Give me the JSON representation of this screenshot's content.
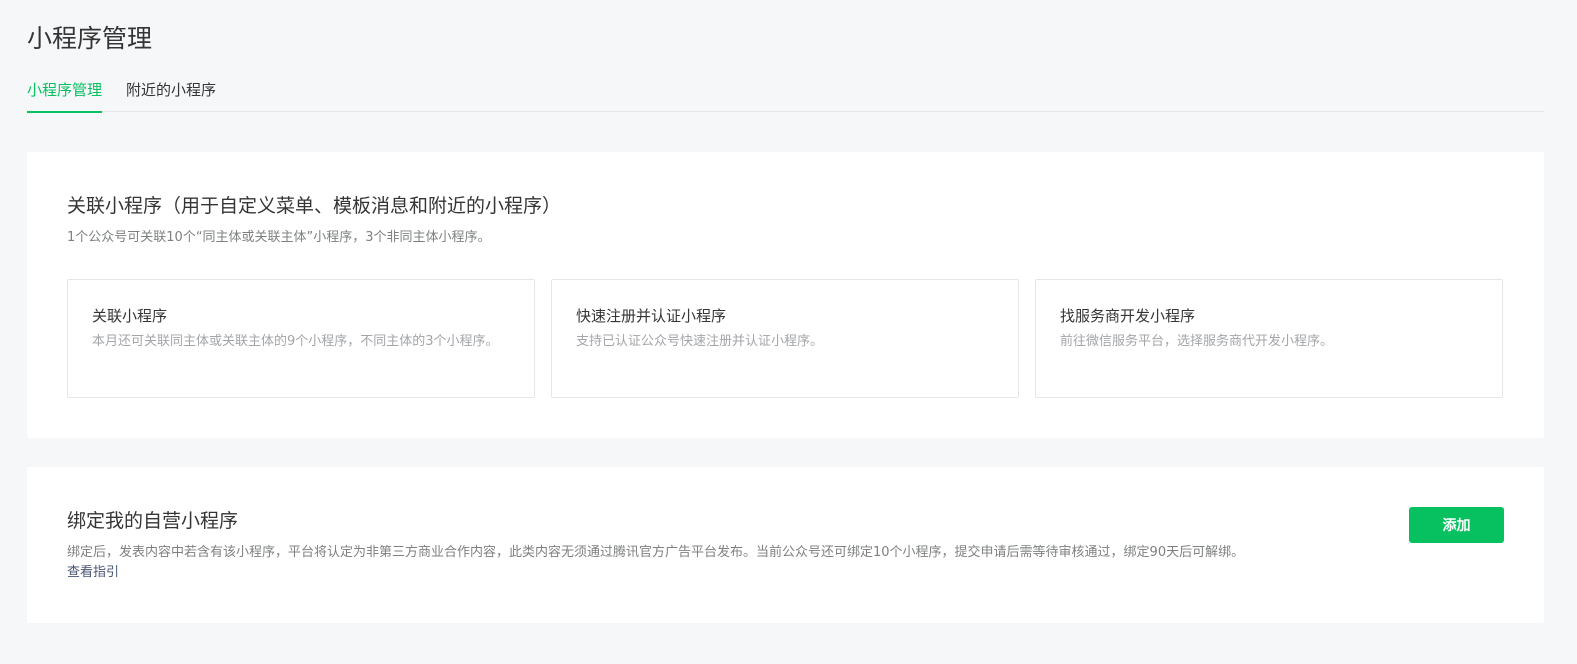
{
  "header": {
    "title": "小程序管理"
  },
  "tabs": [
    {
      "label": "小程序管理",
      "active": true
    },
    {
      "label": "附近的小程序",
      "active": false
    }
  ],
  "link_section": {
    "title": "关联小程序（用于自定义菜单、模板消息和附近的小程序）",
    "description": "1个公众号可关联10个“同主体或关联主体”小程序，3个非同主体小程序。",
    "options": [
      {
        "title": "关联小程序",
        "description": "本月还可关联同主体或关联主体的9个小程序，不同主体的3个小程序。"
      },
      {
        "title": "快速注册并认证小程序",
        "description": "支持已认证公众号快速注册并认证小程序。"
      },
      {
        "title": "找服务商开发小程序",
        "description": "前往微信服务平台，选择服务商代开发小程序。"
      }
    ]
  },
  "bind_section": {
    "title": "绑定我的自营小程序",
    "description": "绑定后，发表内容中若含有该小程序，平台将认定为非第三方商业合作内容，此类内容无须通过腾讯官方广告平台发布。当前公众号还可绑定10个小程序，提交申请后需等待审核通过，绑定90天后可解绑。",
    "guide_link": "查看指引",
    "add_label": "添加"
  },
  "colors": {
    "accent": "#07c160",
    "background": "#f6f7f9",
    "link": "#4a5573"
  }
}
